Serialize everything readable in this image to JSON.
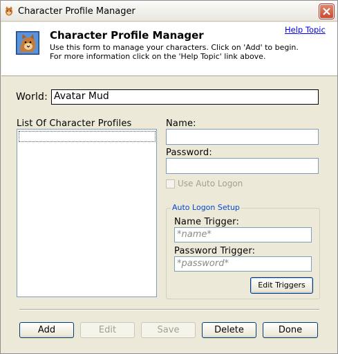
{
  "window": {
    "title": "Character Profile Manager"
  },
  "header": {
    "title": "Character Profile Manager",
    "description": "Use this form to manage your characters. Click on 'Add' to begin. For more information click on the 'Help Topic' link above.",
    "help_link": "Help Topic"
  },
  "world": {
    "label": "World:",
    "value": "Avatar Mud"
  },
  "profiles": {
    "label": "List Of Character Profiles",
    "items": []
  },
  "form": {
    "name_label": "Name:",
    "name_value": "",
    "password_label": "Password:",
    "password_value": "",
    "auto_logon_label": "Use Auto Logon",
    "auto_logon_checked": false
  },
  "auto_logon_setup": {
    "legend": "Auto Logon Setup",
    "name_trigger_label": "Name Trigger:",
    "name_trigger_value": "*name*",
    "password_trigger_label": "Password Trigger:",
    "password_trigger_value": "*password*",
    "edit_triggers_label": "Edit Triggers"
  },
  "buttons": {
    "add": "Add",
    "edit": "Edit",
    "save": "Save",
    "delete": "Delete",
    "done": "Done"
  }
}
